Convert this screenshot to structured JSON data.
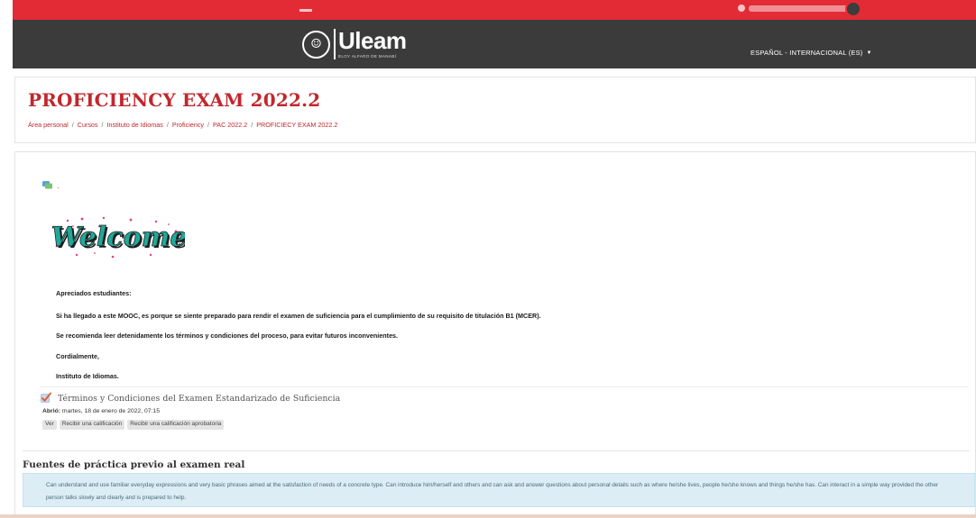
{
  "brand": {
    "name": "Uleam",
    "subtitle": "ELOY ALFARO DE MANABÍ",
    "accent": "#c1272d",
    "topbar_color": "#e32b35",
    "navbar_color": "#3b3b3b"
  },
  "navbar": {
    "language": "ESPAÑOL - INTERNACIONAL (ES)",
    "language_caret": "▼"
  },
  "header": {
    "title": "PROFICIENCY EXAM 2022.2",
    "breadcrumb": [
      "Área personal",
      "Cursos",
      "Instituto de Idiomas",
      "Proficiency",
      "PAC 2022.2",
      "PROFICIECY EXAM 2022.2"
    ],
    "separator": "/"
  },
  "main": {
    "forum_icon": "forum-icon",
    "welcome_image_text": "Welcome",
    "message": [
      "Apreciados estudiantes:",
      "Si ha llegado a este MOOC, es porque se siente preparado para rendir el examen de suficiencia para el cumplimiento de su requisito de titulación B1 (MCER).",
      "Se recomienda leer detenidamente los términos y condiciones del proceso, para evitar futuros inconvenientes.",
      "Cordialmente,",
      "Instituto de Idiomas."
    ],
    "activity": {
      "icon": "checkmark-icon",
      "title": "Términos y Condiciones del Examen Estandarizado de Suficiencia",
      "opened_label": "Abrió:",
      "opened_value": " martes, 18 de enero de 2022, 07:15",
      "badges": [
        "Ver",
        "Recibir una calificación",
        "Recibir una calificación aprobatoria"
      ]
    },
    "section": {
      "title": "Fuentes de práctica previo al examen real",
      "info_text": "Can understand and use familiar everyday expressions and very basic phrases aimed at the satisfaction of needs of a concrete type. Can introduce him/herself and others and can ask and answer questions about personal details such as where he/she lives, people he/she knows and things he/she has. Can interact in a simple way provided the other person talks slowly and clearly and is prepared to help."
    }
  }
}
